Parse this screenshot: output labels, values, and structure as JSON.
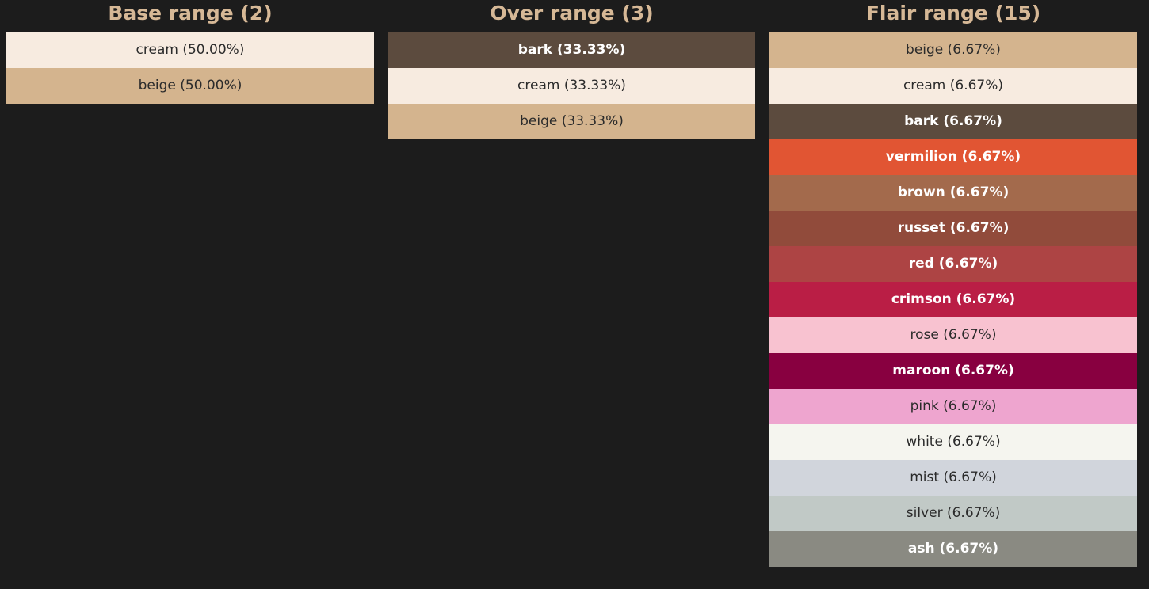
{
  "ranges": [
    {
      "title": "Base range (2)",
      "swatches": [
        {
          "label": "cream (50.00%)",
          "color": "#f7ebe0",
          "text": "dark"
        },
        {
          "label": "beige (50.00%)",
          "color": "#d4b48e",
          "text": "dark"
        }
      ]
    },
    {
      "title": "Over range (3)",
      "swatches": [
        {
          "label": "bark (33.33%)",
          "color": "#5c4b3e",
          "text": "light"
        },
        {
          "label": "cream (33.33%)",
          "color": "#f7ebe0",
          "text": "dark"
        },
        {
          "label": "beige (33.33%)",
          "color": "#d4b48e",
          "text": "dark"
        }
      ]
    },
    {
      "title": "Flair range (15)",
      "swatches": [
        {
          "label": "beige (6.67%)",
          "color": "#d4b48e",
          "text": "dark"
        },
        {
          "label": "cream (6.67%)",
          "color": "#f7ebe0",
          "text": "dark"
        },
        {
          "label": "bark (6.67%)",
          "color": "#5c4b3e",
          "text": "light"
        },
        {
          "label": "vermilion (6.67%)",
          "color": "#e15533",
          "text": "light"
        },
        {
          "label": "brown (6.67%)",
          "color": "#a36a4c",
          "text": "light"
        },
        {
          "label": "russet (6.67%)",
          "color": "#914b3b",
          "text": "light"
        },
        {
          "label": "red (6.67%)",
          "color": "#ad4444",
          "text": "light"
        },
        {
          "label": "crimson (6.67%)",
          "color": "#ba1e45",
          "text": "light"
        },
        {
          "label": "rose (6.67%)",
          "color": "#f8c2d0",
          "text": "dark"
        },
        {
          "label": "maroon (6.67%)",
          "color": "#880040",
          "text": "light"
        },
        {
          "label": "pink (6.67%)",
          "color": "#eea5cf",
          "text": "dark"
        },
        {
          "label": "white (6.67%)",
          "color": "#f5f5ef",
          "text": "dark"
        },
        {
          "label": "mist (6.67%)",
          "color": "#d1d5dc",
          "text": "dark"
        },
        {
          "label": "silver (6.67%)",
          "color": "#c1c9c6",
          "text": "dark"
        },
        {
          "label": "ash (6.67%)",
          "color": "#8a8a82",
          "text": "light"
        }
      ]
    }
  ]
}
